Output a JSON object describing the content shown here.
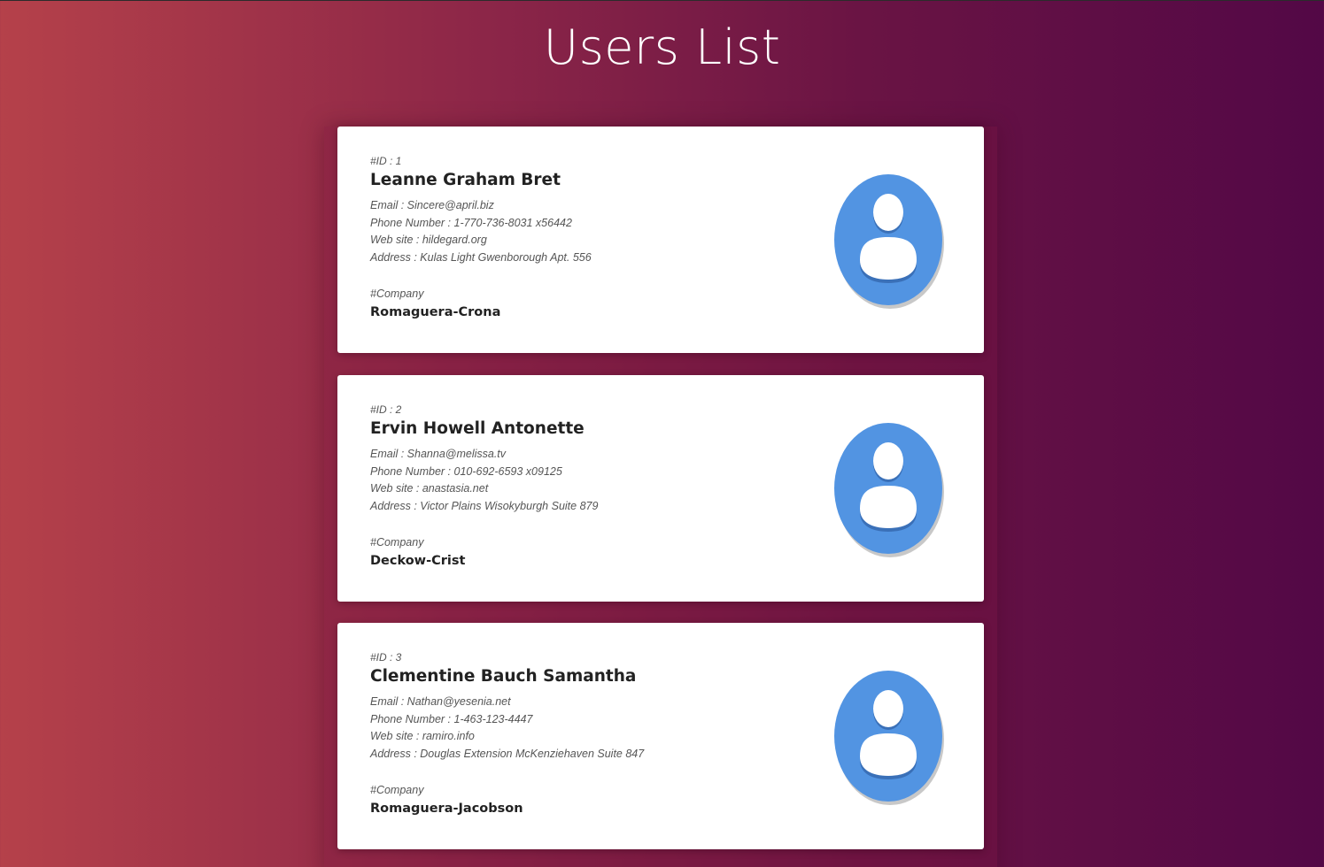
{
  "page": {
    "title": "Users List"
  },
  "labels": {
    "id_prefix": "#ID : ",
    "email_prefix": "Email : ",
    "phone_prefix": "Phone Number : ",
    "website_prefix": "Web site : ",
    "address_prefix": "Address : ",
    "company_tag": "#Company"
  },
  "colors": {
    "background_start": "#b5414a",
    "background_end": "#530846",
    "card": "#ffffff",
    "avatar_blue": "#5294e2"
  },
  "users": [
    {
      "id_text": "#ID : 1",
      "name": "Leanne Graham Bret",
      "email_text": "Email : Sincere@april.biz",
      "phone_text": "Phone Number : 1-770-736-8031 x56442",
      "website_text": "Web site : hildegard.org",
      "address_text": "Address : Kulas Light Gwenborough Apt. 556",
      "company_tag": "#Company",
      "company_name": "Romaguera-Crona",
      "avatar_icon": "user-avatar-icon"
    },
    {
      "id_text": "#ID : 2",
      "name": "Ervin Howell Antonette",
      "email_text": "Email : Shanna@melissa.tv",
      "phone_text": "Phone Number : 010-692-6593 x09125",
      "website_text": "Web site : anastasia.net",
      "address_text": "Address : Victor Plains Wisokyburgh Suite 879",
      "company_tag": "#Company",
      "company_name": "Deckow-Crist",
      "avatar_icon": "user-avatar-icon"
    },
    {
      "id_text": "#ID : 3",
      "name": "Clementine Bauch Samantha",
      "email_text": "Email : Nathan@yesenia.net",
      "phone_text": "Phone Number : 1-463-123-4447",
      "website_text": "Web site : ramiro.info",
      "address_text": "Address : Douglas Extension McKenziehaven Suite 847",
      "company_tag": "#Company",
      "company_name": "Romaguera-Jacobson",
      "avatar_icon": "user-avatar-icon"
    }
  ]
}
